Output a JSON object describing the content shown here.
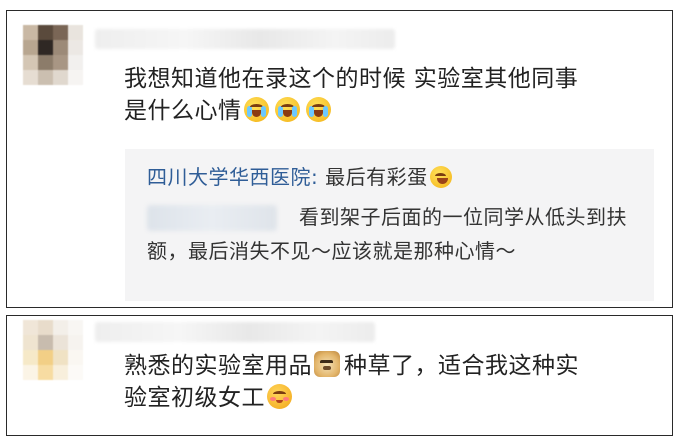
{
  "comment1": {
    "text_line1": "我想知道他在录这个的时候 实验室其他同事",
    "text_line2": "是什么心情",
    "emojis": [
      "crying-laughing-emoji",
      "crying-laughing-emoji",
      "crying-laughing-emoji"
    ],
    "reply": {
      "author": "四川大学华西医院",
      "separator": ":",
      "text": "最后有彩蛋",
      "emoji": "grinning-emoji",
      "sub_reply_text": "看到架子后面的一位同学从低头到扶额，最后消失不见～应该就是那种心情～"
    }
  },
  "comment2": {
    "text_part1": "熟悉的实验室用品",
    "emoji1": "doge-emoji",
    "text_part2": "种草了，适合我这种实",
    "text_line2": "验室初级女工",
    "emoji2": "blush-smile-emoji"
  },
  "colors": {
    "reply_author": "#2f5d97",
    "reply_background": "#f4f4f5",
    "card_border": "#2a2a2a",
    "text": "#222222"
  }
}
